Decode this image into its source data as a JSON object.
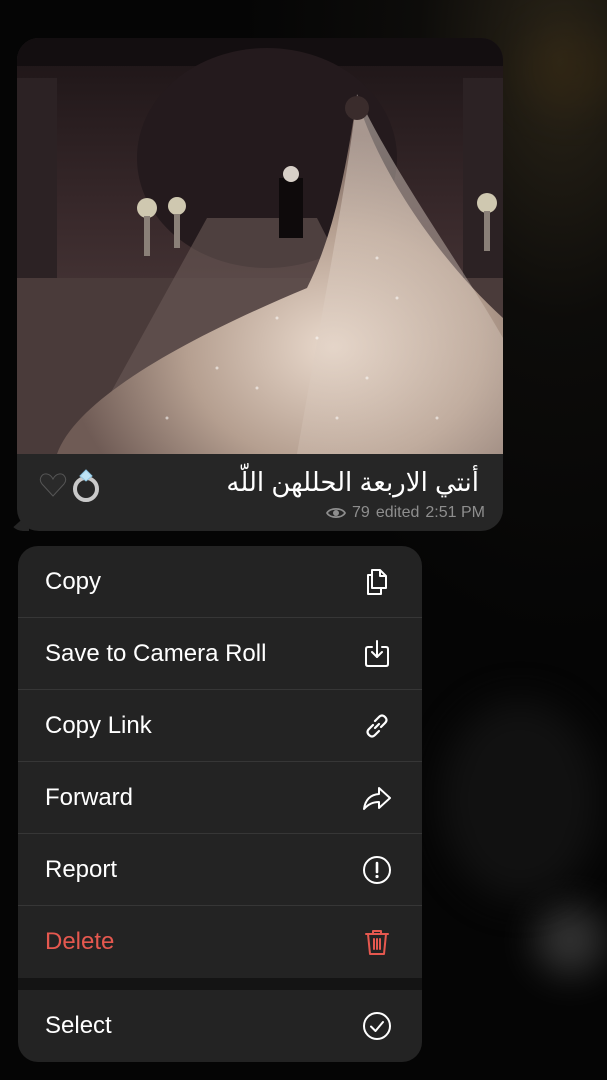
{
  "message": {
    "caption": "أنتي الاربعة الحللهن اللّه",
    "emojis": [
      "🖤",
      "💍"
    ],
    "views": "79",
    "edited_label": "edited",
    "time": "2:51 PM",
    "photo_description": "bride in sparkling gown walking down aisle"
  },
  "context_menu": {
    "items": [
      {
        "label": "Copy",
        "icon": "copy-icon"
      },
      {
        "label": "Save to Camera Roll",
        "icon": "save-download-icon"
      },
      {
        "label": "Copy Link",
        "icon": "link-icon"
      },
      {
        "label": "Forward",
        "icon": "forward-arrow-icon"
      },
      {
        "label": "Report",
        "icon": "exclamation-circle-icon"
      },
      {
        "label": "Delete",
        "icon": "trash-icon"
      },
      {
        "label": "Select",
        "icon": "checkmark-circle-icon"
      }
    ]
  },
  "colors": {
    "danger": "#e5584f",
    "menu_background": "#232323",
    "bubble_background": "#262626",
    "meta_text": "#8e8e8e"
  }
}
